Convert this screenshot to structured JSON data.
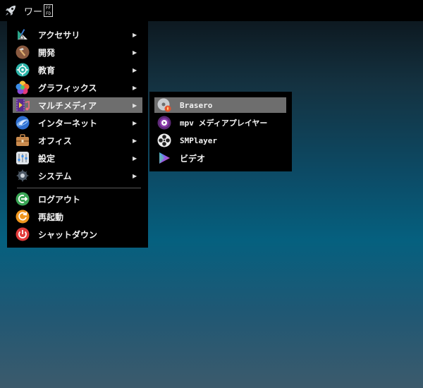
{
  "taskbar": {
    "workspace_label": "ワー",
    "missing_glyph_top": "FF",
    "missing_glyph_bottom": "FD"
  },
  "menu": {
    "items": [
      {
        "label": "アクセサリ",
        "arrow": "▶",
        "icon": "accessories-icon"
      },
      {
        "label": "開発",
        "arrow": "▶",
        "icon": "development-icon"
      },
      {
        "label": "教育",
        "arrow": "▶",
        "icon": "education-icon"
      },
      {
        "label": "グラフィックス",
        "arrow": "▶",
        "icon": "graphics-icon"
      },
      {
        "label": "マルチメディア",
        "arrow": "▶",
        "icon": "multimedia-icon"
      },
      {
        "label": "インターネット",
        "arrow": "▶",
        "icon": "internet-icon"
      },
      {
        "label": "オフィス",
        "arrow": "▶",
        "icon": "office-icon"
      },
      {
        "label": "設定",
        "arrow": "▶",
        "icon": "settings-icon"
      },
      {
        "label": "システム",
        "arrow": "▶",
        "icon": "system-icon"
      }
    ],
    "session": [
      {
        "label": "ログアウト",
        "icon": "logout-icon"
      },
      {
        "label": "再起動",
        "icon": "restart-icon"
      },
      {
        "label": "シャットダウン",
        "icon": "shutdown-icon"
      }
    ],
    "selected": "マルチメディア"
  },
  "submenu": {
    "items": [
      {
        "label": "Brasero",
        "icon": "brasero-icon"
      },
      {
        "label": "mpv メディアプレイヤー",
        "icon": "mpv-icon"
      },
      {
        "label": "SMPlayer",
        "icon": "smplayer-icon"
      },
      {
        "label": "ビデオ",
        "icon": "video-icon"
      }
    ],
    "selected": "Brasero"
  },
  "colors": {
    "menu_bg": "#000000",
    "highlight": "#6e6e6e",
    "text": "#f2f2f2"
  }
}
